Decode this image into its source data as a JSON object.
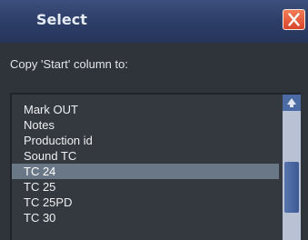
{
  "window": {
    "title": "Select"
  },
  "prompt": "Copy 'Start' column to:",
  "list": {
    "items": [
      "Mark OUT",
      "Notes",
      "Production id",
      "Sound TC",
      "TC 24",
      "TC 25",
      "TC 25PD",
      "TC 30"
    ],
    "selected": "TC 24",
    "scroll_position": 0.65
  },
  "icons": {
    "close": "close-icon",
    "scroll_up": "arrow-up-icon"
  },
  "colors": {
    "titlebar": "#2d3e67",
    "selection": "#6a7787",
    "close_button": "#e05a3a"
  }
}
